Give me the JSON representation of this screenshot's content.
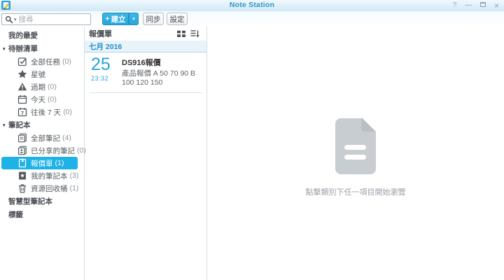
{
  "window": {
    "title": "Note Station"
  },
  "glyphs": {
    "help": "?",
    "minimize": "—",
    "close": "×",
    "collapse": "▾",
    "caret": "▾",
    "plus": "+"
  },
  "toolbar": {
    "search_placeholder": "搜尋",
    "create": "建立",
    "sync": "同步",
    "settings": "設定"
  },
  "sidebar": {
    "items": [
      {
        "type": "header",
        "label": "我的最愛"
      },
      {
        "type": "header",
        "label": "待辦清單",
        "collapsible": true
      },
      {
        "type": "item",
        "icon": "task-icon",
        "label": "全部任務",
        "count": "(0)"
      },
      {
        "type": "item",
        "icon": "star-icon",
        "label": "星號"
      },
      {
        "type": "item",
        "icon": "overdue-icon",
        "label": "過期",
        "count": "(0)"
      },
      {
        "type": "item",
        "icon": "today-icon",
        "label": "今天",
        "count": "(0)"
      },
      {
        "type": "item",
        "icon": "next7days-icon",
        "label": "往後 7 天",
        "count": "(0)"
      },
      {
        "type": "header",
        "label": "筆記本",
        "collapsible": true
      },
      {
        "type": "item",
        "icon": "all-notes-icon",
        "label": "全部筆記",
        "count": "(4)"
      },
      {
        "type": "item",
        "icon": "shared-notes-icon",
        "label": "已分享的筆記",
        "count": "(0)"
      },
      {
        "type": "item",
        "icon": "notebook-icon",
        "label": "報價單",
        "count": "(1)",
        "selected": true
      },
      {
        "type": "item",
        "icon": "my-notebook-icon",
        "label": "我的筆記本",
        "count": "(3)"
      },
      {
        "type": "item",
        "icon": "trash-icon",
        "label": "資源回收桶",
        "count": "(1)"
      },
      {
        "type": "header",
        "label": "智慧型筆記本"
      },
      {
        "type": "header",
        "label": "標籤"
      }
    ]
  },
  "notelist": {
    "title": "報價單",
    "group_header": "七月 2016",
    "notes": [
      {
        "day": "25",
        "time": "23:32",
        "title": "DS916報價",
        "snippet": "產品報價 A 50 70 90 B 100 120 150"
      }
    ]
  },
  "preview": {
    "empty_message": "點擊類別下任一項目開始瀏覽"
  },
  "colors": {
    "accent_button": "#29a6da",
    "selected_item": "#1fb2e6",
    "title_text": "#3095c5",
    "note_date_text": "#2ba3da",
    "group_header_bg": "#e8f3fa",
    "group_header_text": "#1d8fc9",
    "empty_icon": "#c8cdd2"
  }
}
